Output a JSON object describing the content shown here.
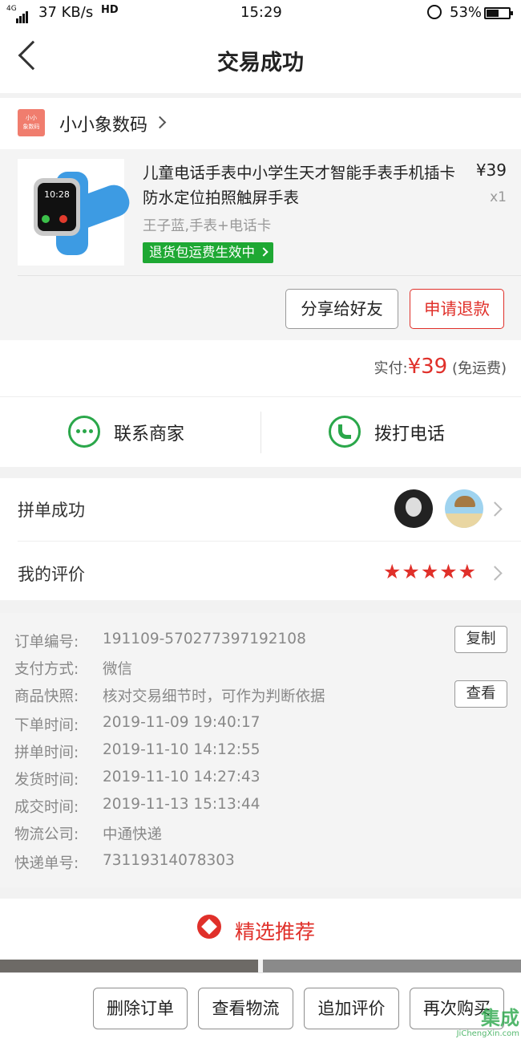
{
  "status_bar": {
    "network": "4G",
    "speed": "37 KB/s",
    "hd": "HD",
    "time": "15:29",
    "battery": "53%",
    "icons": [
      "signal-icon",
      "call-hd-icon",
      "alarm-icon",
      "battery-icon"
    ]
  },
  "nav": {
    "title": "交易成功",
    "back_icon": "chevron-left-icon"
  },
  "shop": {
    "logo_text": "小小象数码",
    "name": "小小象数码"
  },
  "product": {
    "title": "儿童电话手表中小学生天才智能手表手机插卡防水定位拍照触屏手表",
    "price": "¥39",
    "quantity": "x1",
    "spec": "王子蓝,手表+电话卡",
    "badge": "退货包运费生效中",
    "watch_time": "10:28",
    "band_color": "#3d9be3",
    "actions": {
      "share": "分享给好友",
      "refund": "申请退款"
    }
  },
  "payment": {
    "label": "实付:",
    "amount": "¥39",
    "shipping": "(免运费)"
  },
  "contact": {
    "merchant": "联系商家",
    "phone": "拨打电话"
  },
  "group": {
    "label": "拼单成功"
  },
  "review": {
    "label": "我的评价",
    "stars": "★★★★★",
    "rating": 5
  },
  "order_info": {
    "rows": [
      {
        "label": "订单编号:",
        "value": "191109-570277397192108",
        "button": "复制"
      },
      {
        "label": "支付方式:",
        "value": "微信"
      },
      {
        "label": "商品快照:",
        "value": "核对交易细节时，可作为判断依据",
        "button": "查看"
      },
      {
        "label": "下单时间:",
        "value": "2019-11-09 19:40:17"
      },
      {
        "label": "拼单时间:",
        "value": "2019-11-10 14:12:55"
      },
      {
        "label": "发货时间:",
        "value": "2019-11-10 14:27:43"
      },
      {
        "label": "成交时间:",
        "value": "2019-11-13 15:13:44"
      },
      {
        "label": "物流公司:",
        "value": "中通快递"
      },
      {
        "label": "快递单号:",
        "value": "73119314078303"
      }
    ]
  },
  "recommend": {
    "label": "精选推荐"
  },
  "bottom_bar": {
    "buttons": [
      "删除订单",
      "查看物流",
      "追加评价",
      "再次购买"
    ]
  },
  "watermark": {
    "name": "集成",
    "url": "JiChengXin.com"
  },
  "colors": {
    "accent": "#e0302a",
    "green": "#2aa74a",
    "badge_green": "#1ea833"
  }
}
